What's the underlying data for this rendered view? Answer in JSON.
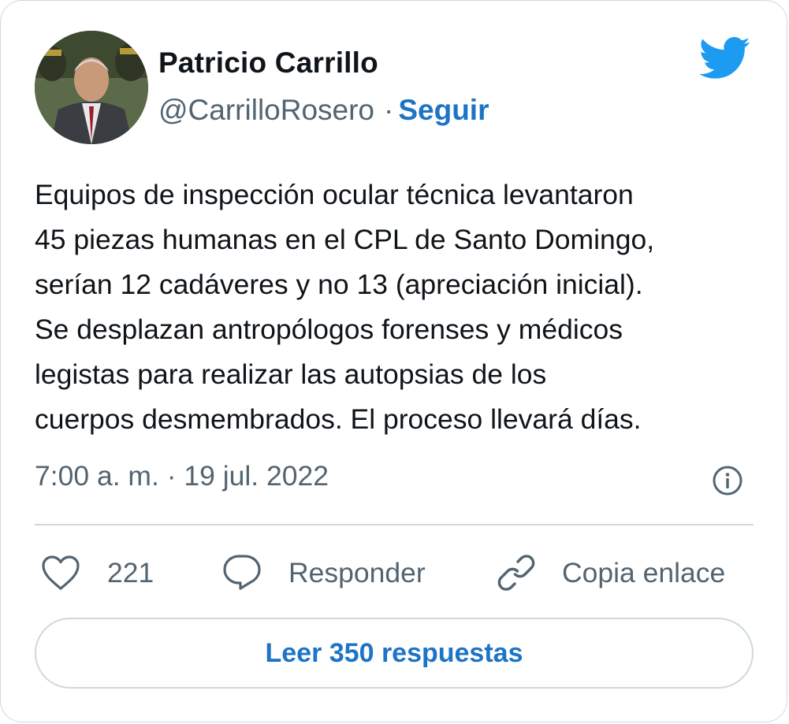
{
  "author": {
    "name": "Patricio Carrillo",
    "handle": "@CarrilloRosero",
    "separator": "·",
    "follow_label": "Seguir",
    "avatar_icon": "profile-photo"
  },
  "brand": {
    "icon": "twitter-bird-icon",
    "color": "#1d9bf0"
  },
  "tweet": {
    "lines": [
      "Equipos de inspección ocular técnica levantaron",
      "45 piezas humanas en el CPL de Santo Domingo,",
      "serían 12 cadáveres y no 13 (apreciación inicial).",
      "Se desplazan antropólogos forenses y médicos",
      "legistas para realizar las autopsias de los",
      "cuerpos desmembrados. El proceso llevará días."
    ],
    "timestamp": "7:00 a. m. · 19 jul. 2022"
  },
  "actions": {
    "like_count": "221",
    "reply_label": "Responder",
    "copy_label": "Copia enlace"
  },
  "read_replies_label": "Leer 350 respuestas",
  "colors": {
    "link": "#1d74c6",
    "text": "#0f1419",
    "secondary": "#536471",
    "border": "#cfd9de"
  }
}
